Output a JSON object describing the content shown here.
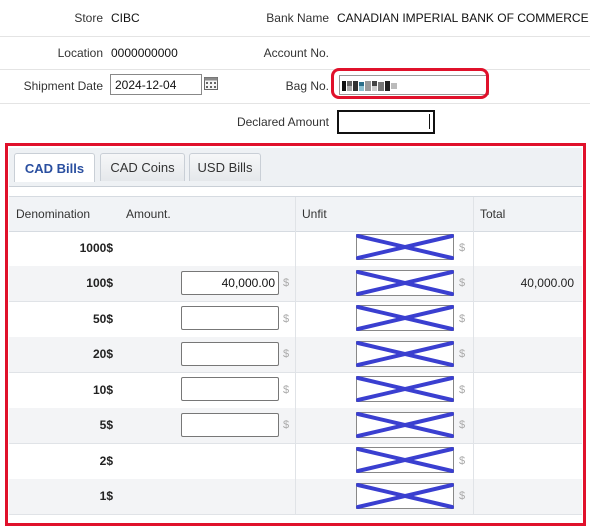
{
  "header": {
    "store_label": "Store",
    "store_value": "CIBC",
    "bank_name_label": "Bank Name",
    "bank_name_value": "CANADIAN IMPERIAL BANK OF COMMERCE",
    "location_label": "Location",
    "location_value": "0000000000",
    "account_no_label": "Account No.",
    "account_no_value": "",
    "shipment_date_label": "Shipment Date",
    "shipment_date_value": "2024-12-04",
    "bag_no_label": "Bag No.",
    "bag_no_value": "",
    "declared_amount_label": "Declared Amount",
    "declared_amount_value": ""
  },
  "tabs": [
    {
      "label": "CAD Bills",
      "active": true
    },
    {
      "label": "CAD Coins",
      "active": false
    },
    {
      "label": "USD Bills",
      "active": false
    }
  ],
  "grid": {
    "columns": [
      "Denomination",
      "Amount.",
      "Unfit",
      "Total"
    ],
    "currency_symbol": "$",
    "rows": [
      {
        "denomination": "1000$",
        "amount": null,
        "total": ""
      },
      {
        "denomination": "100$",
        "amount": "40,000.00",
        "total": "40,000.00"
      },
      {
        "denomination": "50$",
        "amount": "",
        "total": ""
      },
      {
        "denomination": "20$",
        "amount": "",
        "total": ""
      },
      {
        "denomination": "10$",
        "amount": "",
        "total": ""
      },
      {
        "denomination": "5$",
        "amount": "",
        "total": ""
      },
      {
        "denomination": "2$",
        "amount": null,
        "total": ""
      },
      {
        "denomination": "1$",
        "amount": null,
        "total": ""
      }
    ]
  },
  "colors": {
    "highlight": "#e0112b",
    "cross_out": "#3a3fd0",
    "active_tab_text": "#2a4fa0"
  },
  "icons": {
    "calendar": "calendar-icon",
    "unfit_crossed": "crossed-out-field-icon"
  }
}
